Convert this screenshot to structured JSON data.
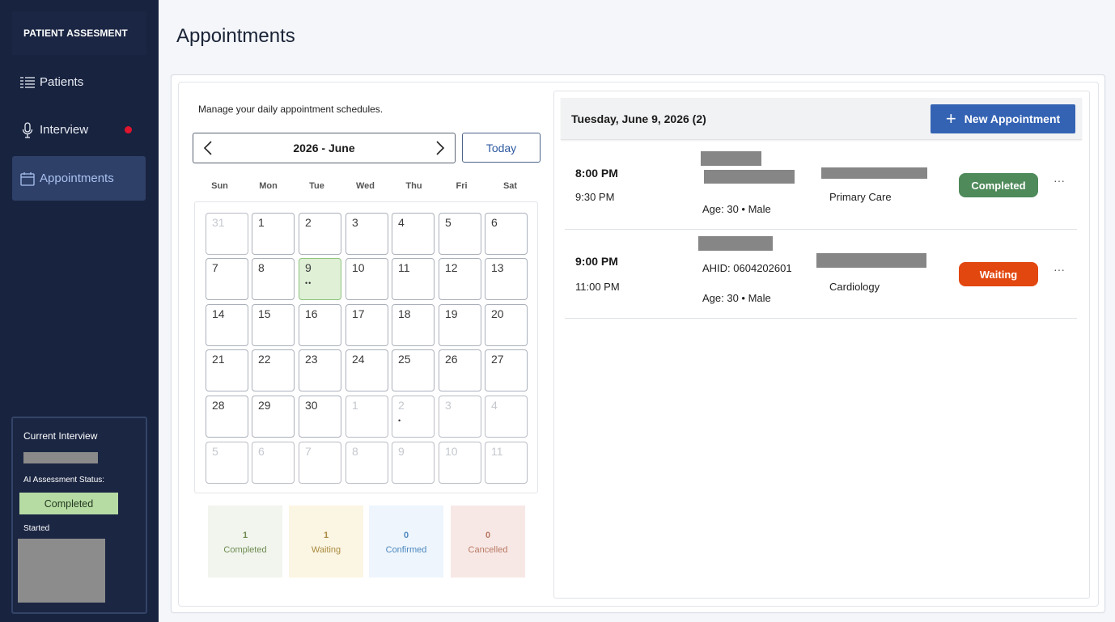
{
  "sidebar": {
    "brand": "PATIENT ASSESMENT",
    "items": [
      {
        "label": "Patients",
        "icon": "list-icon"
      },
      {
        "label": "Interview",
        "icon": "microphone-icon"
      },
      {
        "label": "Appointments",
        "icon": "calendar-icon"
      }
    ],
    "current_interview": {
      "title": "Current Interview",
      "status_label": "AI Assessment Status:",
      "status": "Completed",
      "started_label": "Started"
    }
  },
  "page": {
    "title": "Appointments"
  },
  "calendar": {
    "subtitle": "Manage your daily appointment schedules.",
    "month_label": "2026 - June",
    "today_label": "Today",
    "weekdays": [
      "Sun",
      "Mon",
      "Tue",
      "Wed",
      "Thu",
      "Fri",
      "Sat"
    ],
    "days": [
      {
        "d": "31",
        "muted": true,
        "dots": ""
      },
      {
        "d": "1",
        "muted": false,
        "dots": ""
      },
      {
        "d": "2",
        "muted": false,
        "dots": ""
      },
      {
        "d": "3",
        "muted": false,
        "dots": ""
      },
      {
        "d": "4",
        "muted": false,
        "dots": ""
      },
      {
        "d": "5",
        "muted": false,
        "dots": ""
      },
      {
        "d": "6",
        "muted": false,
        "dots": ""
      },
      {
        "d": "7",
        "muted": false,
        "dots": ""
      },
      {
        "d": "8",
        "muted": false,
        "dots": ""
      },
      {
        "d": "9",
        "muted": false,
        "dots": "••",
        "selected": true
      },
      {
        "d": "10",
        "muted": false,
        "dots": ""
      },
      {
        "d": "11",
        "muted": false,
        "dots": ""
      },
      {
        "d": "12",
        "muted": false,
        "dots": ""
      },
      {
        "d": "13",
        "muted": false,
        "dots": ""
      },
      {
        "d": "14",
        "muted": false,
        "dots": ""
      },
      {
        "d": "15",
        "muted": false,
        "dots": ""
      },
      {
        "d": "16",
        "muted": false,
        "dots": ""
      },
      {
        "d": "17",
        "muted": false,
        "dots": ""
      },
      {
        "d": "18",
        "muted": false,
        "dots": ""
      },
      {
        "d": "19",
        "muted": false,
        "dots": ""
      },
      {
        "d": "20",
        "muted": false,
        "dots": ""
      },
      {
        "d": "21",
        "muted": false,
        "dots": ""
      },
      {
        "d": "22",
        "muted": false,
        "dots": ""
      },
      {
        "d": "23",
        "muted": false,
        "dots": ""
      },
      {
        "d": "24",
        "muted": false,
        "dots": ""
      },
      {
        "d": "25",
        "muted": false,
        "dots": ""
      },
      {
        "d": "26",
        "muted": false,
        "dots": ""
      },
      {
        "d": "27",
        "muted": false,
        "dots": ""
      },
      {
        "d": "28",
        "muted": false,
        "dots": ""
      },
      {
        "d": "29",
        "muted": false,
        "dots": ""
      },
      {
        "d": "30",
        "muted": false,
        "dots": ""
      },
      {
        "d": "1",
        "muted": true,
        "dots": ""
      },
      {
        "d": "2",
        "muted": true,
        "dots": "•"
      },
      {
        "d": "3",
        "muted": true,
        "dots": ""
      },
      {
        "d": "4",
        "muted": true,
        "dots": ""
      },
      {
        "d": "5",
        "muted": true,
        "dots": ""
      },
      {
        "d": "6",
        "muted": true,
        "dots": ""
      },
      {
        "d": "7",
        "muted": true,
        "dots": ""
      },
      {
        "d": "8",
        "muted": true,
        "dots": ""
      },
      {
        "d": "9",
        "muted": true,
        "dots": ""
      },
      {
        "d": "10",
        "muted": true,
        "dots": ""
      },
      {
        "d": "11",
        "muted": true,
        "dots": ""
      }
    ]
  },
  "stats": [
    {
      "count": "1",
      "label": "Completed",
      "bg": "#f1f5ee",
      "color": "#6e8a4f"
    },
    {
      "count": "1",
      "label": "Waiting",
      "bg": "#fbf5e3",
      "color": "#a98a3f"
    },
    {
      "count": "0",
      "label": "Confirmed",
      "bg": "#eef5fc",
      "color": "#4d88bf"
    },
    {
      "count": "0",
      "label": "Cancelled",
      "bg": "#f7e8e6",
      "color": "#b97a63"
    }
  ],
  "schedule": {
    "header": "Tuesday, June 9, 2026 (2)",
    "new_button": "New Appointment",
    "appointments": [
      {
        "start": "8:00 PM",
        "end": "9:30 PM",
        "ahid": "",
        "age": "Age: 30 • Male",
        "dept": "Primary Care",
        "status": "Completed",
        "status_color": "#4e8a5a"
      },
      {
        "start": "9:00 PM",
        "end": "11:00 PM",
        "ahid": "AHID: 0604202601",
        "age": "Age: 30 • Male",
        "dept": "Cardiology",
        "status": "Waiting",
        "status_color": "#e2470f"
      }
    ],
    "more_label": "···"
  },
  "colors": {
    "sidebar_bg": "#18233f",
    "primary": "#3463b4",
    "completed": "#4e8a5a",
    "waiting": "#e2470f"
  }
}
